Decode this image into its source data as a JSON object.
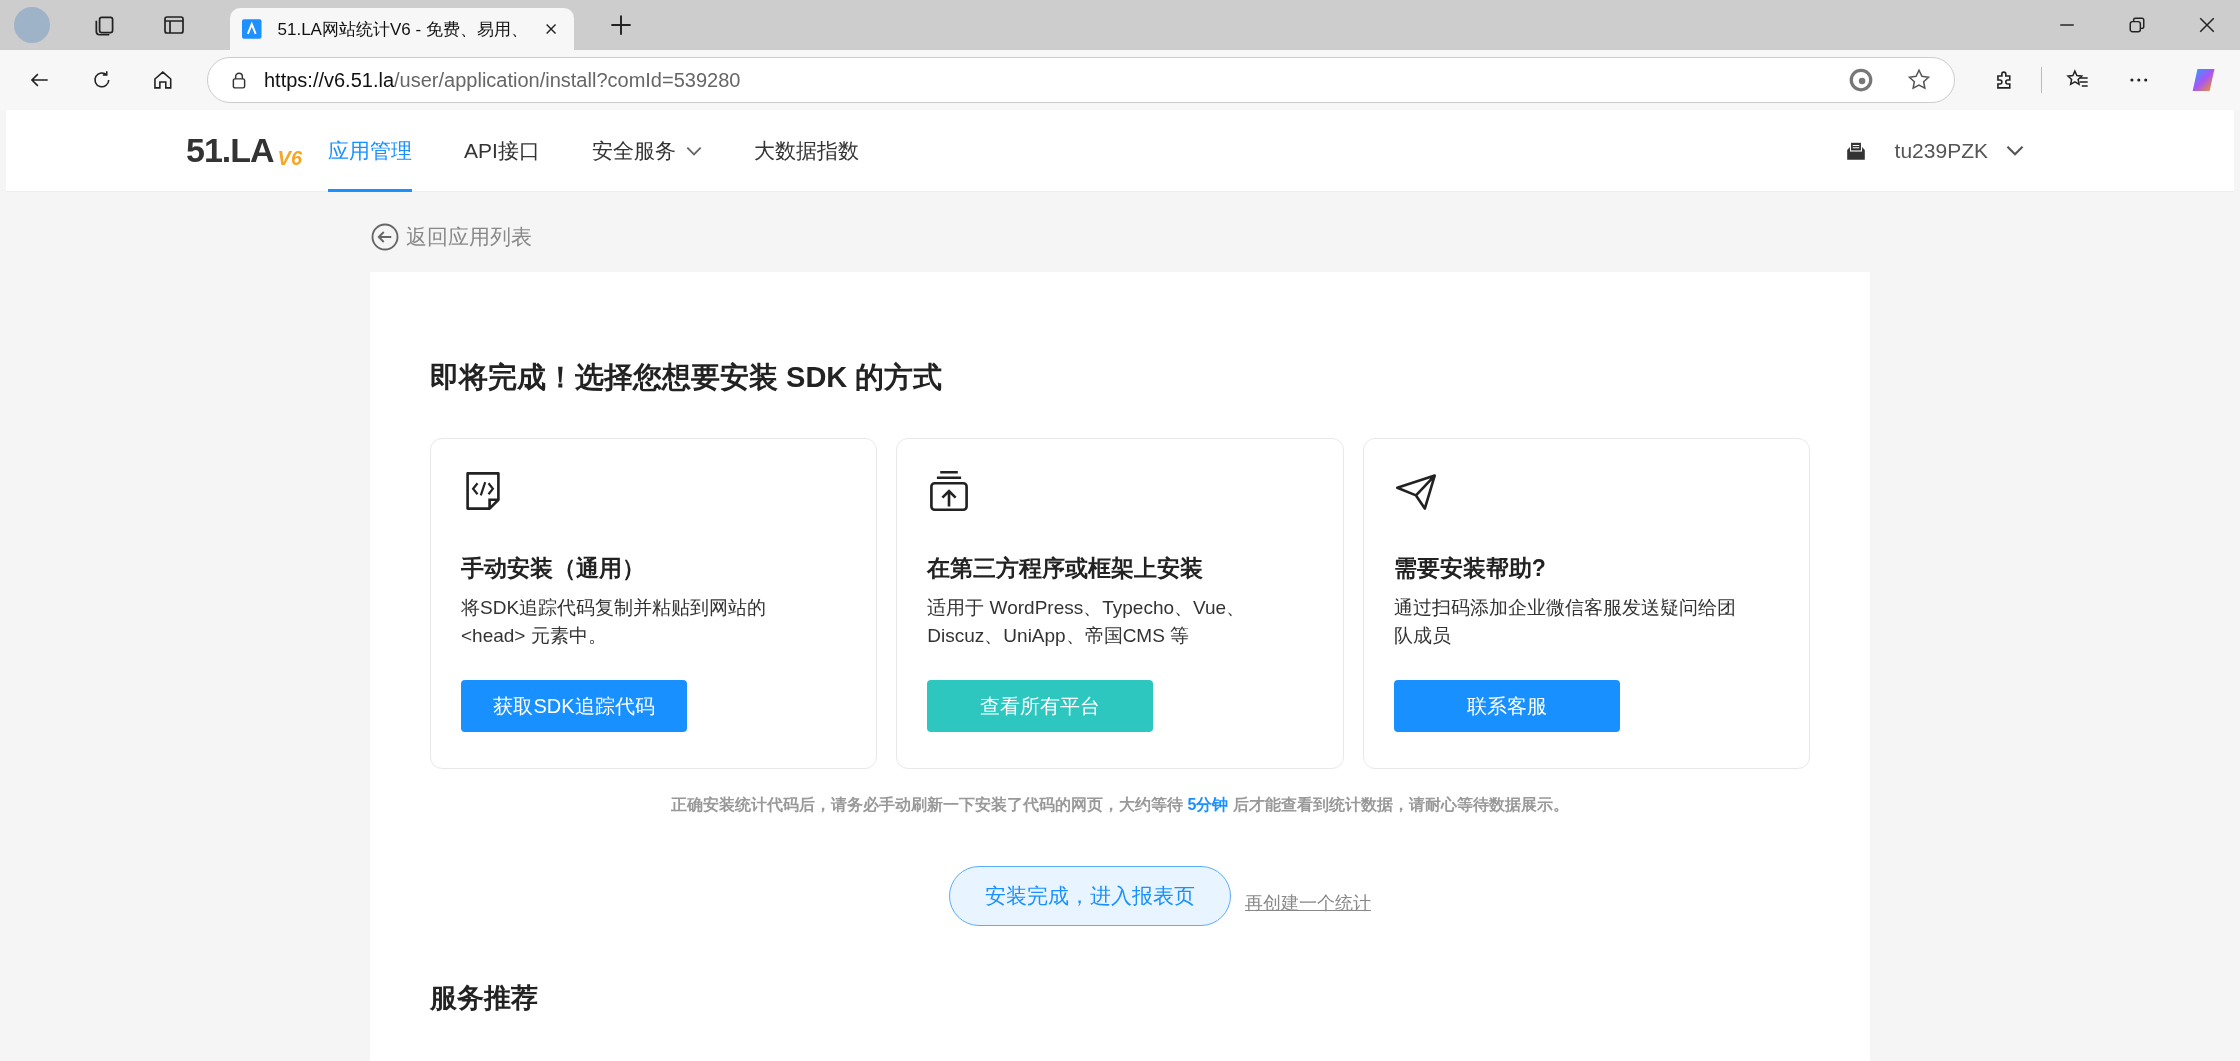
{
  "browser": {
    "tab_title": "51.LA网站统计V6 - 免费、易用、",
    "url_host": "https://v6.51.la",
    "url_path": "/user/application/install?comId=539280"
  },
  "nav": {
    "logo": "51.LA",
    "logo_version": "V6",
    "items": [
      {
        "label": "应用管理",
        "selected": true,
        "dropdown": false
      },
      {
        "label": "API接口",
        "selected": false,
        "dropdown": false
      },
      {
        "label": "安全服务",
        "selected": false,
        "dropdown": true
      },
      {
        "label": "大数据指数",
        "selected": false,
        "dropdown": false
      }
    ],
    "user": "tu239PZK"
  },
  "back_link": "返回应用列表",
  "title": "即将完成！选择您想要安装 SDK 的方式",
  "cards": [
    {
      "kind": "code",
      "title": "手动安装（通用）",
      "description": "将SDK追踪代码复制并粘贴到网站的<head> 元素中。",
      "button": "获取SDK追踪代码"
    },
    {
      "kind": "platform",
      "title": "在第三方程序或框架上安装",
      "description": "适用于 WordPress、Typecho、Vue、Discuz、UniApp、帝国CMS 等",
      "button": "查看所有平台"
    },
    {
      "kind": "help",
      "title": "需要安装帮助?",
      "description": "通过扫码添加企业微信客服发送疑问给团队成员",
      "button": "联系客服"
    }
  ],
  "notice": {
    "before": "正确安装统计代码后，请务必手动刷新一下安装了代码的网页，大约等待 ",
    "highlight": "5分钟",
    "after": " 后才能查看到统计数据，请耐心等待数据展示。"
  },
  "finish_button": "安装完成，进入报表页",
  "create_link": "再创建一个统计",
  "section_title": "服务推荐"
}
